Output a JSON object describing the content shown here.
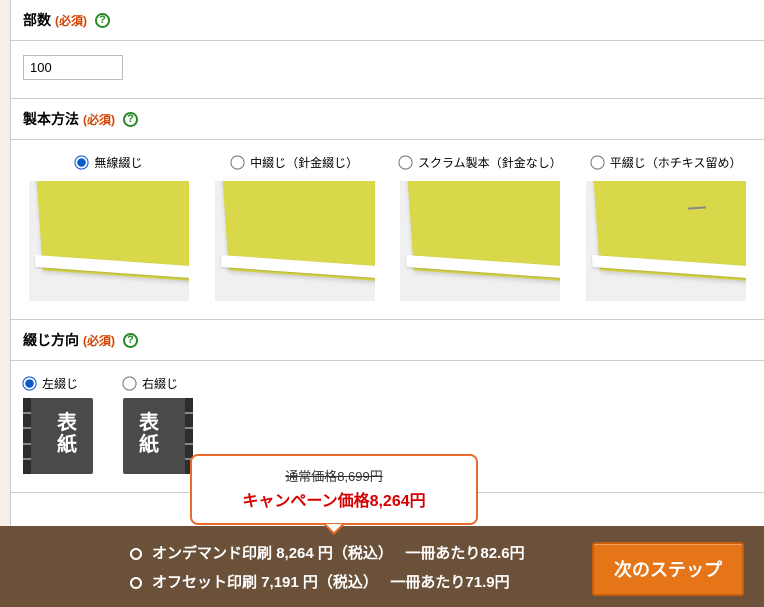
{
  "sections": {
    "quantity": {
      "label": "部数",
      "required": "(必須)",
      "value": "100"
    },
    "binding": {
      "label": "製本方法",
      "required": "(必須)",
      "options": [
        {
          "label": "無線綴じ",
          "checked": true,
          "staple": false
        },
        {
          "label": "中綴じ（針金綴じ）",
          "checked": false,
          "staple": false
        },
        {
          "label": "スクラム製本（針金なし）",
          "checked": false,
          "staple": false
        },
        {
          "label": "平綴じ（ホチキス留め）",
          "checked": false,
          "staple": true
        }
      ]
    },
    "direction": {
      "label": "綴じ方向",
      "required": "(必須)",
      "options": [
        {
          "label": "左綴じ",
          "side": "left",
          "checked": true
        },
        {
          "label": "右綴じ",
          "side": "right",
          "checked": false
        }
      ],
      "cover_text": "表紙"
    }
  },
  "tooltip": {
    "normal": "通常価格8,699円",
    "campaign": "キャンペーン価格8,264円"
  },
  "footer": {
    "ondemand_label": "オンデマンド印刷",
    "ondemand_price": "8,264 円（税込）",
    "ondemand_per": "一冊あたり82.6円",
    "offset_label": "オフセット印刷",
    "offset_price": "7,191 円（税込）",
    "offset_per": "一冊あたり71.9円",
    "next": "次のステップ"
  }
}
